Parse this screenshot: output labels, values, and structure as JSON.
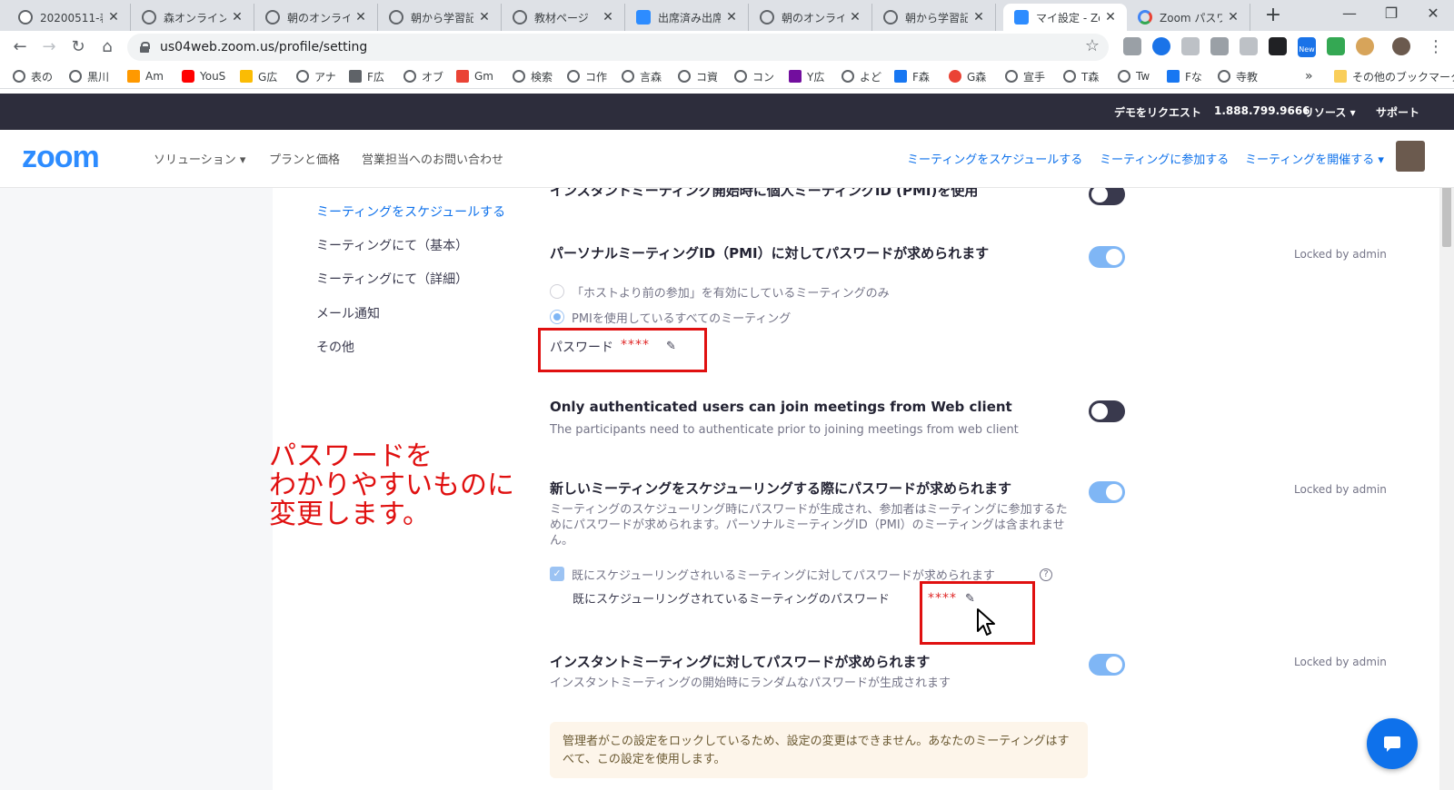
{
  "browser": {
    "tabs": [
      {
        "title": "20200511-表…",
        "icon": "globe-icon"
      },
      {
        "title": "森オンライン…",
        "icon": "globe-icon"
      },
      {
        "title": "朝のオンライン…",
        "icon": "globe-icon"
      },
      {
        "title": "朝から学習記…",
        "icon": "globe-icon"
      },
      {
        "title": "教材ページ",
        "icon": "globe-icon"
      },
      {
        "title": "出席済み出席…",
        "icon": "zoom-icon"
      },
      {
        "title": "朝のオンライン…",
        "icon": "globe-icon"
      },
      {
        "title": "朝から学習記…",
        "icon": "globe-icon"
      },
      {
        "title": "マイ設定 - Zoo",
        "icon": "zoom-icon",
        "active": true
      },
      {
        "title": "Zoom パスワー…",
        "icon": "google-icon"
      }
    ],
    "url": "us04web.zoom.us/profile/setting",
    "bookmarks": [
      "表の",
      "黒川",
      "Am",
      "YouS",
      "G広",
      "アナ",
      "F広",
      "オブ",
      "Gm",
      "検索",
      "コ作",
      "言森",
      "コ資",
      "コン",
      "Y広",
      "よど",
      "F森",
      "G森",
      "宣手",
      "T森",
      "Tw",
      "Fな",
      "寺教"
    ],
    "other_bookmarks": "その他のブックマーク",
    "ext_badge": "New"
  },
  "zoom": {
    "topbar": {
      "demo": "デモをリクエスト",
      "phone": "1.888.799.9666",
      "resources": "リソース ▾",
      "support": "サポート"
    },
    "logo": "zoom",
    "nav": {
      "solutions": "ソリューション ▾",
      "plans": "プランと価格",
      "contact": "営業担当へのお問い合わせ",
      "schedule": "ミーティングをスケジュールする",
      "join": "ミーティングに参加する",
      "host": "ミーティングを開催する ▾"
    },
    "sidebar": [
      {
        "label": "ミーティングをスケジュールする",
        "active": true
      },
      {
        "label": "ミーティングにて（基本）"
      },
      {
        "label": "ミーティングにて（詳細）"
      },
      {
        "label": "メール通知"
      },
      {
        "label": "その他"
      }
    ],
    "settings": {
      "s0_title": "インスタントミーティング開始時に個人ミーティングID (PMI)を使用",
      "s1_title": "パーソナルミーティングID（PMI）に対してパスワードが求められます",
      "s1_locked": "Locked by admin",
      "s1_opt1": "「ホストより前の参加」を有効にしているミーティングのみ",
      "s1_opt2": "PMIを使用しているすべてのミーティング",
      "s1_pw_label": "パスワード",
      "s1_pw_value": "****",
      "s2_title": "Only authenticated users can join meetings from Web client",
      "s2_desc": "The participants need to authenticate prior to joining meetings from web client",
      "s3_title": "新しいミーティングをスケジューリングする際にパスワードが求められます",
      "s3_desc": "ミーティングのスケジューリング時にパスワードが生成され、参加者はミーティングに参加するためにパスワードが求められます。パーソナルミーティングID（PMI）のミーティングは含まれません。",
      "s3_locked": "Locked by admin",
      "s3_check": "既にスケジューリングされいるミーティングに対してパスワードが求められます",
      "s3_pw_label": "既にスケジューリングされているミーティングのパスワード",
      "s3_pw_value": "****",
      "s4_title": "インスタントミーティングに対してパスワードが求められます",
      "s4_desc": "インスタントミーティングの開始時にランダムなパスワードが生成されます",
      "s4_locked": "Locked by admin",
      "notice": "管理者がこの設定をロックしているため、設定の変更はできません。あなたのミーティングはすべて、この設定を使用します。"
    },
    "annotation": [
      "パスワードを",
      "わかりやすいものに",
      "変更します。"
    ]
  }
}
